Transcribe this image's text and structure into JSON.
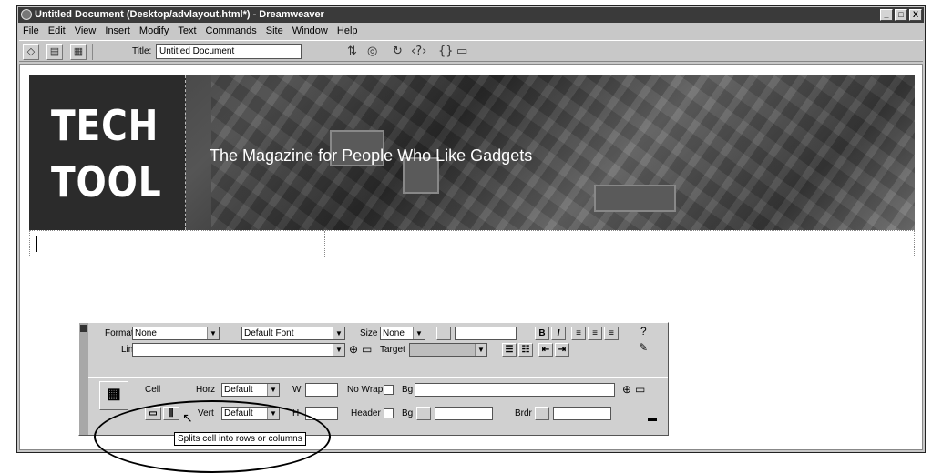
{
  "window": {
    "title": "Untitled Document (Desktop/advlayout.html*) - Dreamweaver",
    "controls": [
      "_",
      "□",
      "X"
    ]
  },
  "menu": [
    "File",
    "Edit",
    "View",
    "Insert",
    "Modify",
    "Text",
    "Commands",
    "Site",
    "Window",
    "Help"
  ],
  "toolbar": {
    "title_label": "Title:",
    "title_value": "Untitled Document"
  },
  "banner": {
    "logo_line1": "TECH",
    "logo_line2": "TOOL",
    "tagline": "The Magazine for People Who Like Gadgets"
  },
  "properties": {
    "format_label": "Format",
    "format_value": "None",
    "font_value": "Default Font",
    "size_label": "Size",
    "size_value": "None",
    "link_label": "Link",
    "target_label": "Target",
    "bold_label": "B",
    "italic_label": "I",
    "cell_label": "Cell",
    "horz_label": "Horz",
    "horz_value": "Default",
    "w_label": "W",
    "nowrap_label": "No Wrap",
    "bg_label": "Bg",
    "vert_label": "Vert",
    "vert_value": "Default",
    "h_label": "H",
    "header_label": "Header",
    "bg2_label": "Bg",
    "brdr_label": "Brdr"
  },
  "tooltip": "Splits cell into rows or columns"
}
